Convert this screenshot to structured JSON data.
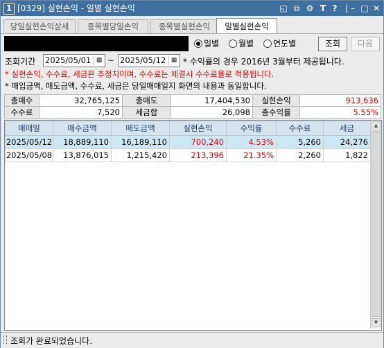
{
  "window": {
    "number": "1",
    "title": "[0329] 실현손익 - 일별 실현손익"
  },
  "tabs": [
    "당일실현손익상세",
    "종목별당일손익",
    "종목별실현손익",
    "일별실현손익"
  ],
  "radios": [
    "일별",
    "월별",
    "연도별"
  ],
  "buttons": {
    "search": "조회",
    "next": "다음"
  },
  "period": {
    "label": "조회기간",
    "start": "2025/05/01",
    "sep": "~",
    "end": "2025/05/12",
    "note": "* 수익률의 경우 2016년 3월부터 제공됩니다."
  },
  "notes": {
    "red": "* 실현손익, 수수료, 세금은 추정치이며, 수수료는 체결시 수수료율로 적용됩니다.",
    "black": "* 매입금액, 매도금액, 수수료, 세금은 당일매매일지 화면의 내용과 동일합니다."
  },
  "summary": {
    "row1": [
      {
        "label": "총매수",
        "value": "32,765,125"
      },
      {
        "label": "총매도",
        "value": "17,404,530"
      },
      {
        "label": "실현손익",
        "value": "913,636"
      }
    ],
    "row2": [
      {
        "label": "수수료",
        "value": "7,520"
      },
      {
        "label": "세금합",
        "value": "26,098"
      },
      {
        "label": "총수익률",
        "value": "5.55%"
      }
    ]
  },
  "grid": {
    "headers": [
      "매매일",
      "매수금액",
      "매도금액",
      "실현손익",
      "수익률",
      "수수료",
      "세금"
    ],
    "rows": [
      [
        "2025/05/12",
        "18,889,110",
        "16,189,110",
        "700,240",
        "4.53%",
        "5,260",
        "24,276"
      ],
      [
        "2025/05/08",
        "13,876,015",
        "1,215,420",
        "213,396",
        "21.35%",
        "2,260",
        "1,822"
      ]
    ]
  },
  "status": "조회가 완료되었습니다.",
  "colors": {
    "title": "#3f6f9f",
    "red": "#e00000",
    "selected_row": "#cde8f5",
    "header": "#d6e4f0"
  }
}
